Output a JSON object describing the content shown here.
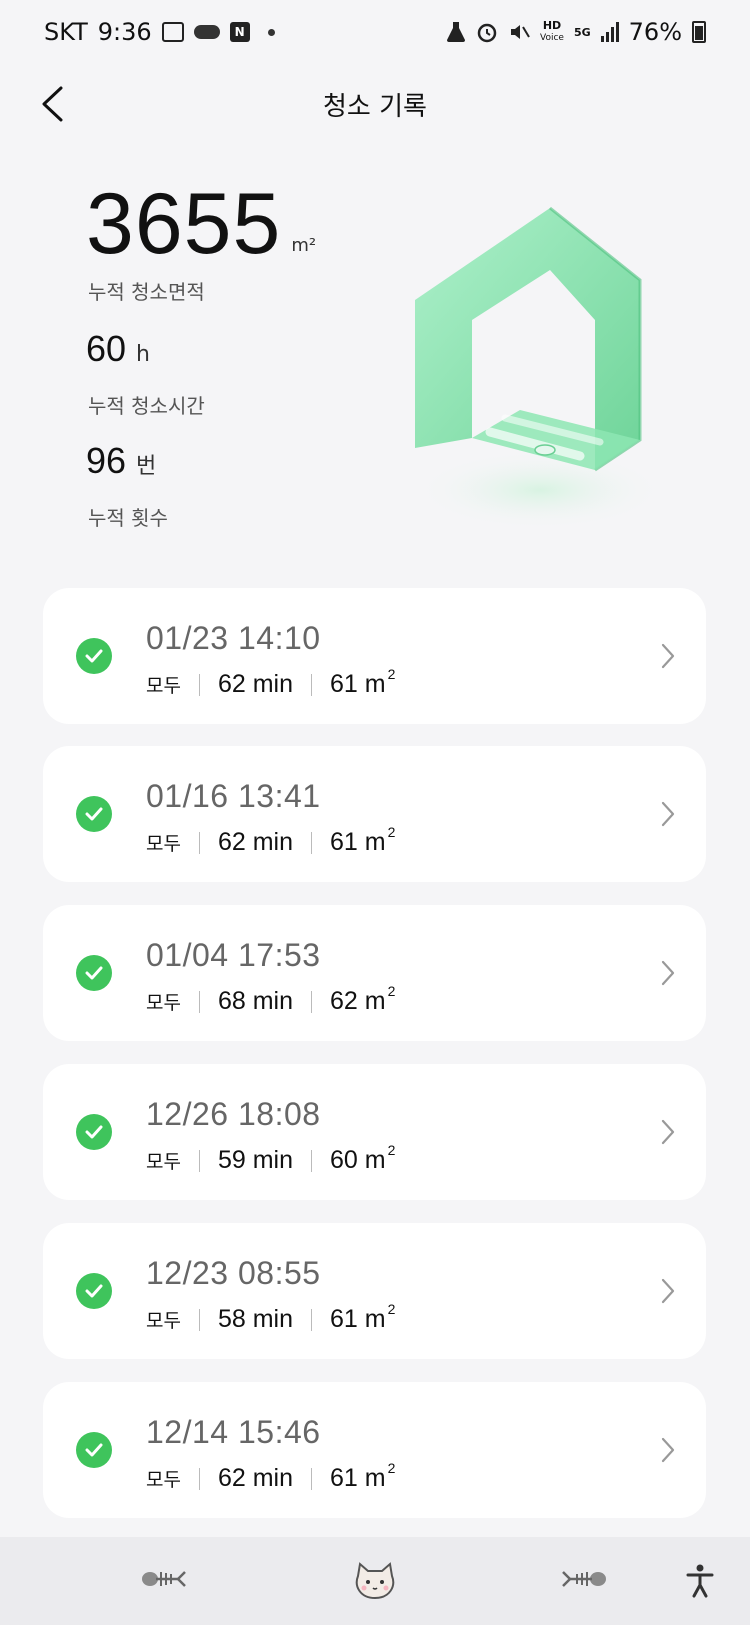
{
  "status_bar": {
    "carrier": "SKT",
    "time": "9:36",
    "network": "5G",
    "hd_label": "HD",
    "voice_label": "Voice",
    "battery": "76%"
  },
  "header": {
    "title": "청소 기록"
  },
  "summary": {
    "area_value": "3655",
    "area_unit": "m²",
    "area_label": "누적 청소면적",
    "time_value": "60",
    "time_unit": "h",
    "time_label": "누적 청소시간",
    "count_value": "96",
    "count_unit": "번",
    "count_label": "누적 횟수"
  },
  "records": [
    {
      "date": "01/23  14:10",
      "mode": "모두",
      "duration": "62 min",
      "area": "61 m",
      "area_sup": "2"
    },
    {
      "date": "01/16  13:41",
      "mode": "모두",
      "duration": "62 min",
      "area": "61 m",
      "area_sup": "2"
    },
    {
      "date": "01/04  17:53",
      "mode": "모두",
      "duration": "68 min",
      "area": "62 m",
      "area_sup": "2"
    },
    {
      "date": "12/26  18:08",
      "mode": "모두",
      "duration": "59 min",
      "area": "60 m",
      "area_sup": "2"
    },
    {
      "date": "12/23  08:55",
      "mode": "모두",
      "duration": "58 min",
      "area": "61 m",
      "area_sup": "2"
    },
    {
      "date": "12/14  15:46",
      "mode": "모두",
      "duration": "62 min",
      "area": "61 m",
      "area_sup": "2"
    }
  ],
  "colors": {
    "accent_green": "#3fc45c",
    "house_green": "#7fe0a8",
    "background": "#f5f5f7",
    "card": "#ffffff"
  },
  "icons": {
    "back": "chevron-left-icon",
    "check": "check-circle-icon",
    "chevron": "chevron-right-icon",
    "nav_left": "fishbone-icon",
    "nav_center": "cat-face-icon",
    "nav_right": "fishbone-icon",
    "accessibility": "accessibility-icon"
  }
}
